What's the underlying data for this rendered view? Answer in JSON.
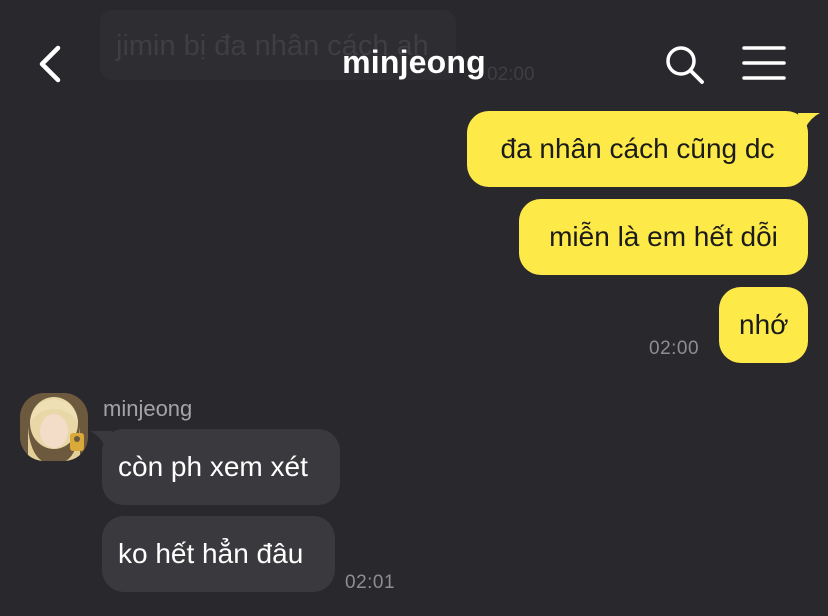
{
  "header": {
    "title": "minjeong",
    "back_icon": "chevron-left-icon",
    "search_icon": "search-icon",
    "menu_icon": "hamburger-menu-icon"
  },
  "ghost_message": {
    "text": "jimin bị đa nhân cách ah",
    "time": "02:00"
  },
  "outgoing": {
    "messages": [
      "đa nhân cách cũng dc",
      "miễn là em hết dỗi",
      "nhớ"
    ],
    "time": "02:00",
    "bubble_color": "#fdea49"
  },
  "incoming": {
    "sender": "minjeong",
    "messages": [
      "còn ph xem xét",
      "ko hết hẳn đâu"
    ],
    "time": "02:01",
    "bubble_color": "#3a3a3e"
  },
  "colors": {
    "background": "#29282c",
    "text_light": "#ffffff",
    "timestamp": "#8e8d92"
  }
}
